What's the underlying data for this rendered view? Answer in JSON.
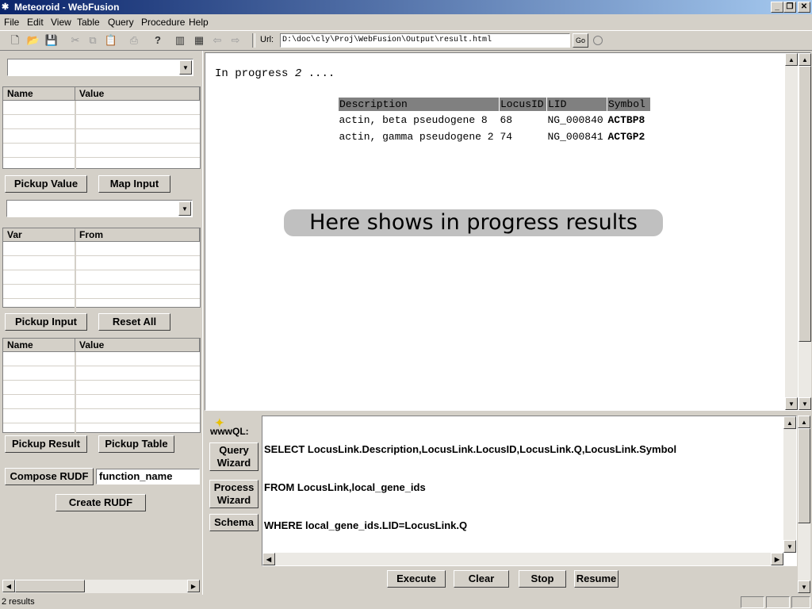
{
  "window": {
    "title": "Meteoroid - WebFusion",
    "buttons": [
      "_",
      "❐",
      "✕"
    ]
  },
  "menu": [
    "File",
    "Edit",
    "View",
    "Table",
    "Query",
    "Procedure",
    "Help"
  ],
  "toolbar": {
    "url_label": "Url:",
    "url_value": "D:\\doc\\cly\\Proj\\WebFusion\\Output\\result.html",
    "go_label": "Go"
  },
  "left": {
    "grid1": {
      "col1": "Name",
      "col2": "Value"
    },
    "pickup_value": "Pickup Value",
    "map_input": "Map Input",
    "grid2": {
      "col1": "Var",
      "col2": "From"
    },
    "pickup_input": "Pickup Input",
    "reset_all": "Reset All",
    "grid3": {
      "col1": "Name",
      "col2": "Value"
    },
    "pickup_result": "Pickup Result",
    "pickup_table": "Pickup Table",
    "compose_rudf": "Compose RUDF",
    "function_name": "function_name",
    "create_rudf": "Create RUDF"
  },
  "browser": {
    "progress_prefix": "In progress",
    "progress_num": "2",
    "progress_suffix": "....",
    "headers": [
      "Description",
      "LocusID",
      "LID",
      "Symbol"
    ],
    "rows": [
      [
        "actin, beta pseudogene 8",
        "68",
        "NG_000840",
        "ACTBP8"
      ],
      [
        "actin, gamma pseudogene 2",
        "74",
        "NG_000841",
        "ACTGP2"
      ]
    ],
    "note": "Here shows in progress results"
  },
  "query": {
    "logo": "wwwQL:",
    "query_wizard": [
      "Query",
      "Wizard"
    ],
    "process_wizard": [
      "Process",
      "Wizard"
    ],
    "schema": "Schema",
    "lines": [
      "SELECT LocusLink.Description,LocusLink.LocusID,LocusLink.Q,LocusLink.Symbol",
      "FROM LocusLink,local_gene_ids",
      "WHERE local_gene_ids.LID=LocusLink.Q"
    ],
    "execute": "Execute",
    "clear": "Clear",
    "stop": "Stop",
    "resume": "Resume"
  },
  "status": {
    "text": "2 results"
  }
}
